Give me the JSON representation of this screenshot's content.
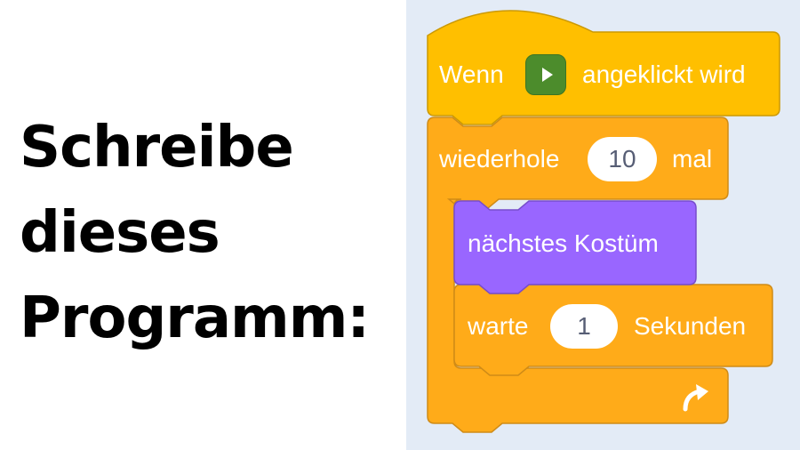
{
  "instruction": {
    "lines": [
      "Schreibe",
      "dieses",
      "Programm:"
    ]
  },
  "colors": {
    "workspace": "#e3ebf6",
    "events": "#ffbf00",
    "control": "#ffab19",
    "looks": "#9966ff",
    "flag": "#4c8c2c"
  },
  "script": {
    "hat": {
      "prefix": "Wenn",
      "icon": "green-flag-icon",
      "suffix": "angeklickt wird"
    },
    "repeat": {
      "label": "wiederhole",
      "count": "10",
      "suffix": "mal",
      "end_icon": "repeat-arrow-icon"
    },
    "next_costume": {
      "label": "nächstes Kostüm"
    },
    "wait": {
      "label": "warte",
      "value": "1",
      "suffix": "Sekunden"
    }
  }
}
